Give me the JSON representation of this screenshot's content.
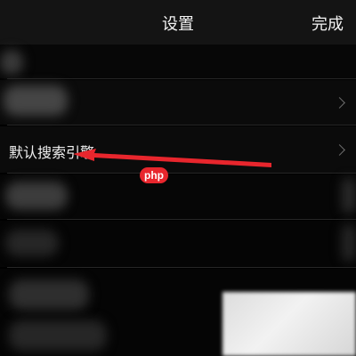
{
  "navbar": {
    "title": "设置",
    "done_label": "完成"
  },
  "rows": {
    "search_engine_label": "默认搜索引擎"
  },
  "icons": {
    "chevron": "chevron-right-icon",
    "annotation": "arrow-left-icon"
  },
  "colors": {
    "background": "#000000",
    "annotation_arrow": "#e8262d",
    "watermark": "#e8262d"
  },
  "watermark": {
    "text": "php"
  }
}
